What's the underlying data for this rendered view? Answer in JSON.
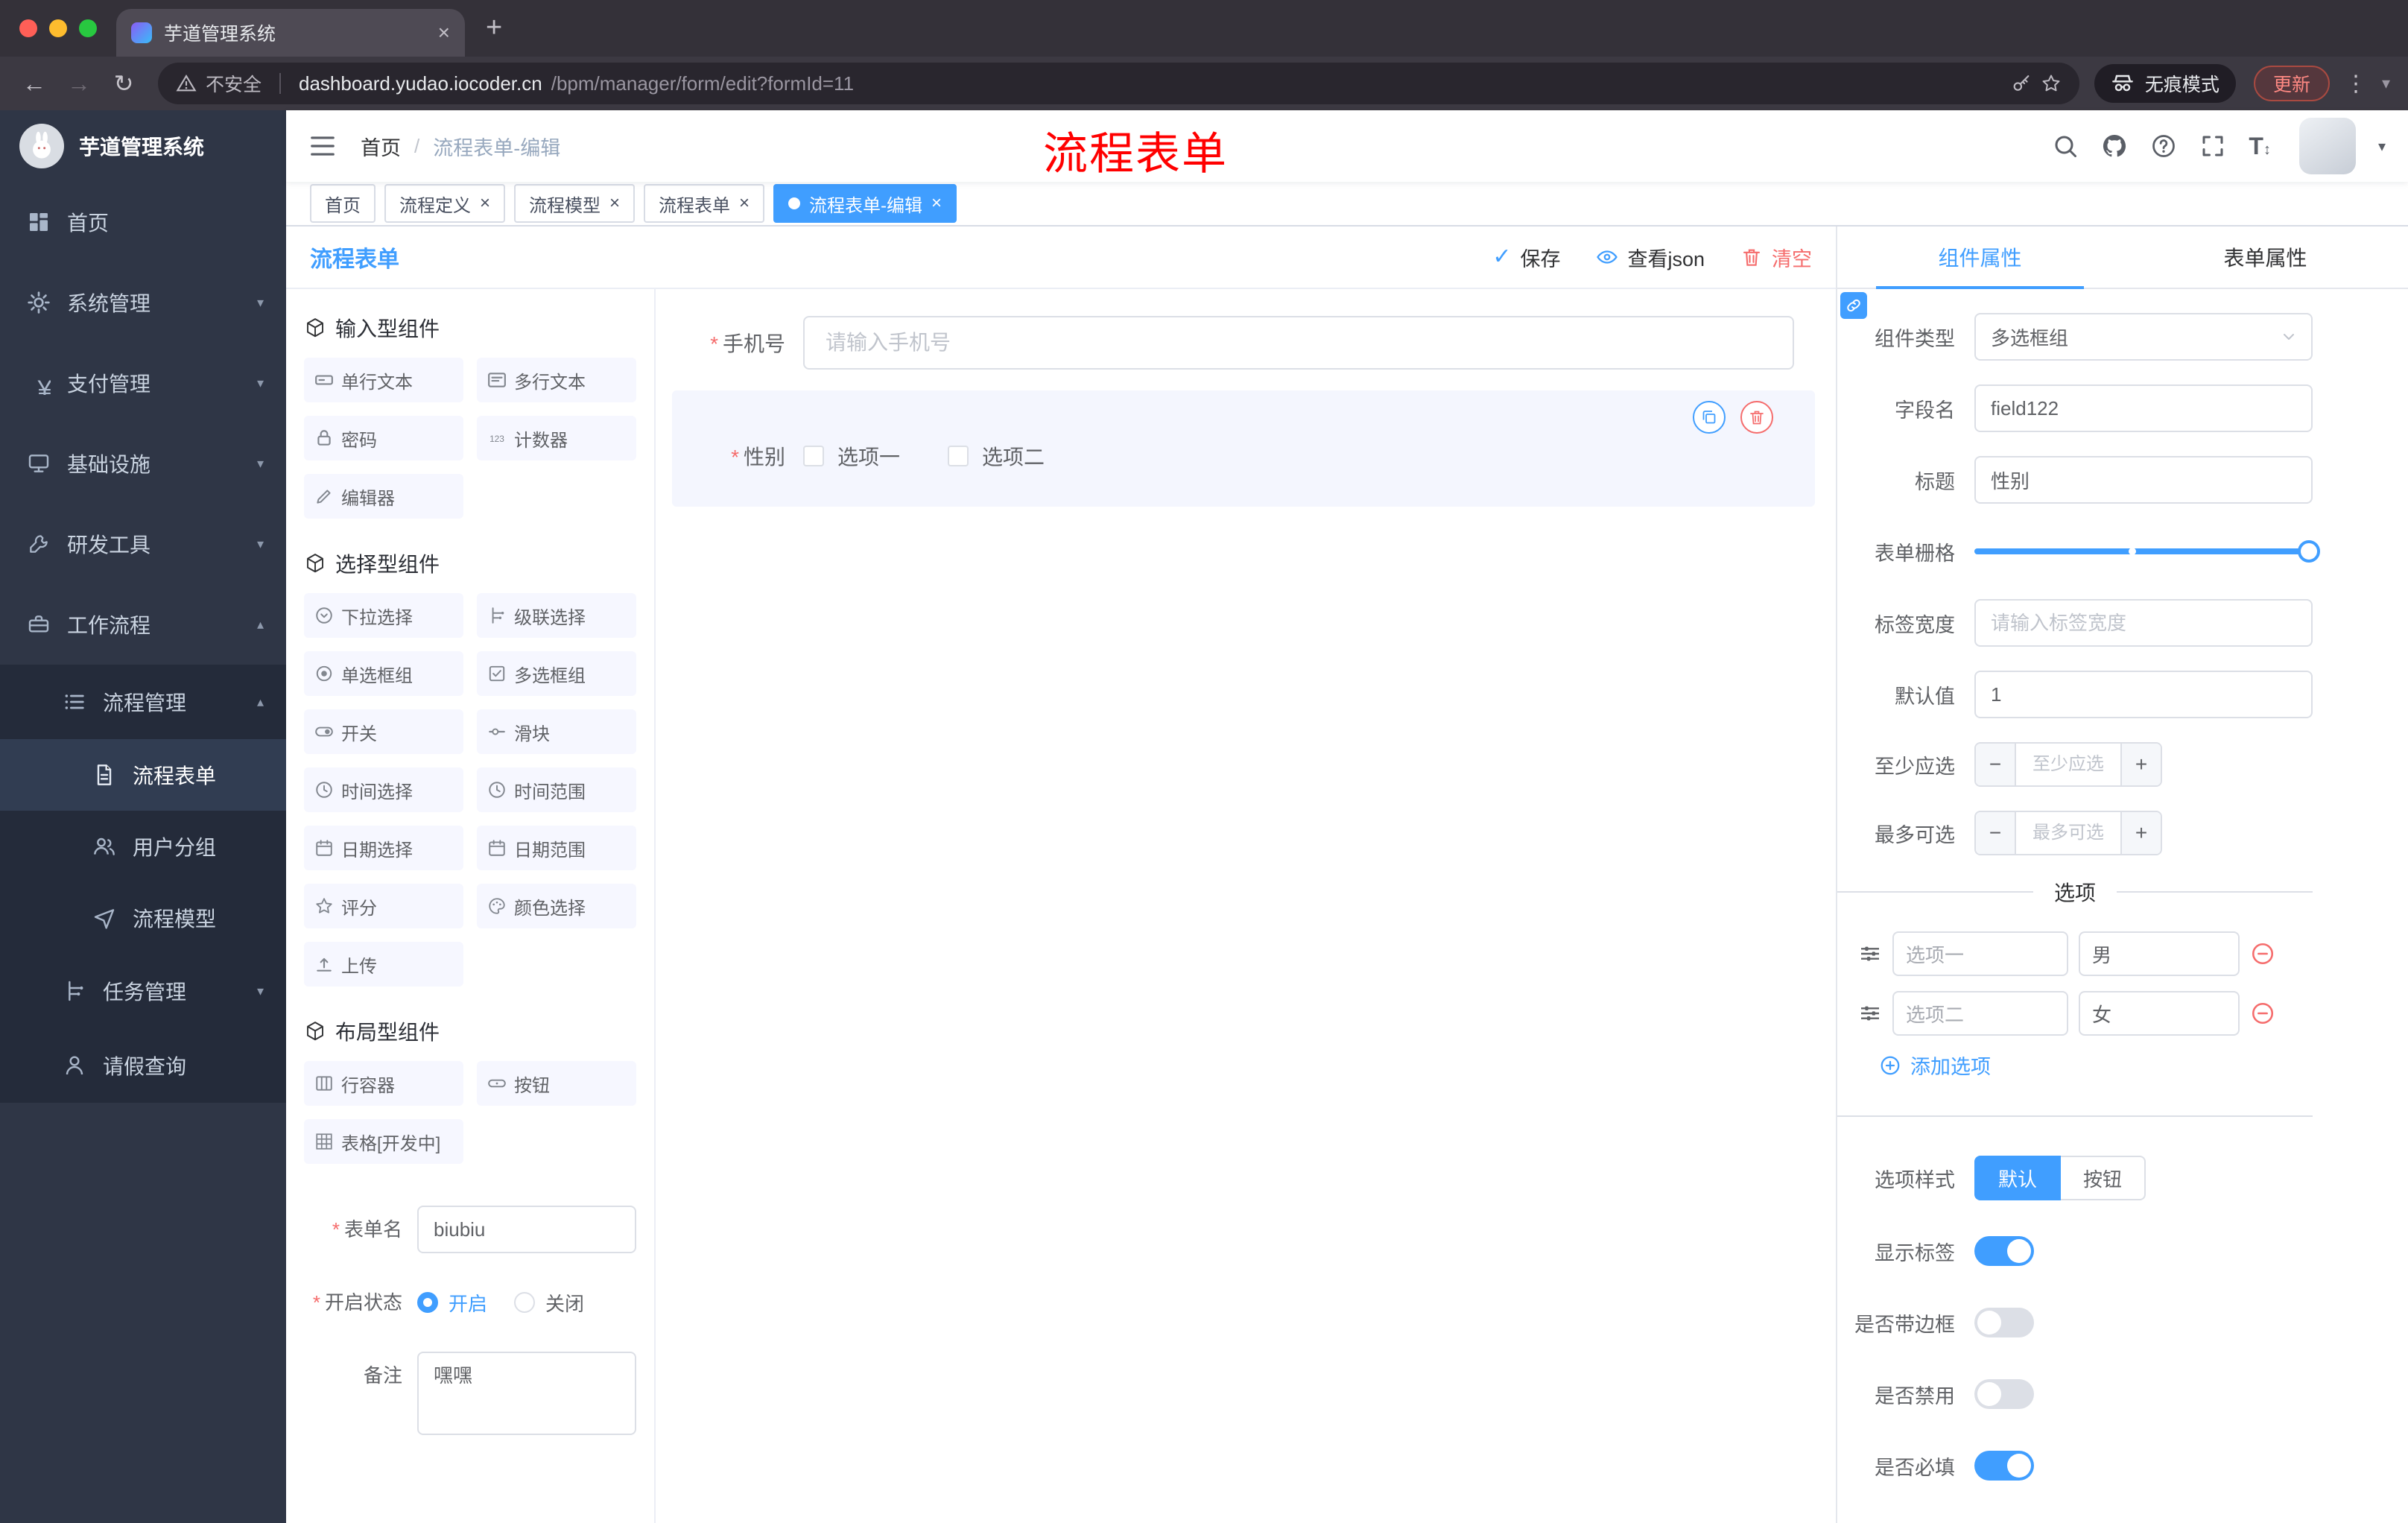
{
  "chrome": {
    "tab_title": "芋道管理系统",
    "security": "不安全",
    "url_host": "dashboard.yudao.iocoder.cn",
    "url_path": "/bpm/manager/form/edit?formId=11",
    "incognito": "无痕模式",
    "update": "更新"
  },
  "sidebar": {
    "title": "芋道管理系统",
    "items": [
      {
        "label": "首页"
      },
      {
        "label": "系统管理"
      },
      {
        "label": "支付管理"
      },
      {
        "label": "基础设施"
      },
      {
        "label": "研发工具"
      },
      {
        "label": "工作流程"
      },
      {
        "label": "流程管理"
      },
      {
        "label": "流程表单"
      },
      {
        "label": "用户分组"
      },
      {
        "label": "流程模型"
      },
      {
        "label": "任务管理"
      },
      {
        "label": "请假查询"
      }
    ]
  },
  "navbar": {
    "breadcrumb_home": "首页",
    "breadcrumb_current": "流程表单-编辑",
    "annotation": "流程表单"
  },
  "tags": [
    {
      "label": "首页"
    },
    {
      "label": "流程定义"
    },
    {
      "label": "流程模型"
    },
    {
      "label": "流程表单"
    },
    {
      "label": "流程表单-编辑"
    }
  ],
  "editor": {
    "title": "流程表单",
    "actions": {
      "save": "保存",
      "view_json": "查看json",
      "clear": "清空"
    },
    "palette": {
      "sections": [
        {
          "title": "输入型组件",
          "items": [
            {
              "label": "单行文本"
            },
            {
              "label": "多行文本"
            },
            {
              "label": "密码"
            },
            {
              "label": "计数器"
            },
            {
              "label": "编辑器"
            }
          ]
        },
        {
          "title": "选择型组件",
          "items": [
            {
              "label": "下拉选择"
            },
            {
              "label": "级联选择"
            },
            {
              "label": "单选框组"
            },
            {
              "label": "多选框组"
            },
            {
              "label": "开关"
            },
            {
              "label": "滑块"
            },
            {
              "label": "时间选择"
            },
            {
              "label": "时间范围"
            },
            {
              "label": "日期选择"
            },
            {
              "label": "日期范围"
            },
            {
              "label": "评分"
            },
            {
              "label": "颜色选择"
            },
            {
              "label": "上传"
            }
          ]
        },
        {
          "title": "布局型组件",
          "items": [
            {
              "label": "行容器"
            },
            {
              "label": "按钮"
            },
            {
              "label": "表格[开发中]"
            }
          ]
        }
      ]
    },
    "meta": {
      "name_label": "表单名",
      "name_value": "biubiu",
      "status_label": "开启状态",
      "status_on": "开启",
      "status_off": "关闭",
      "remark_label": "备注",
      "remark_value": "嘿嘿"
    },
    "canvas": {
      "phone_label": "手机号",
      "phone_placeholder": "请输入手机号",
      "gender_label": "性别",
      "gender_option1": "选项一",
      "gender_option2": "选项二"
    }
  },
  "props": {
    "tab_component": "组件属性",
    "tab_form": "表单属性",
    "type_label": "组件类型",
    "type_value": "多选框组",
    "field_label": "字段名",
    "field_value": "field122",
    "title_label": "标题",
    "title_value": "性别",
    "grid_label": "表单栅格",
    "labelwidth_label": "标签宽度",
    "labelwidth_placeholder": "请输入标签宽度",
    "default_label": "默认值",
    "default_value": "1",
    "min_label": "至少应选",
    "min_placeholder": "至少应选",
    "max_label": "最多可选",
    "max_placeholder": "最多可选",
    "options_title": "选项",
    "options": [
      {
        "label": "选项一",
        "value": "男"
      },
      {
        "label": "选项二",
        "value": "女"
      }
    ],
    "add_option": "添加选项",
    "style_label": "选项样式",
    "style_default": "默认",
    "style_button": "按钮",
    "toggle_show_label": "显示标签",
    "toggle_border": "是否带边框",
    "toggle_disabled": "是否禁用",
    "toggle_required": "是否必填"
  },
  "colors": {
    "accent": "#409eff",
    "danger": "#f56c6c",
    "annotation_red": "#ff0000",
    "active_tag": "#409eff",
    "sidebar_bg": "#2f3646"
  }
}
